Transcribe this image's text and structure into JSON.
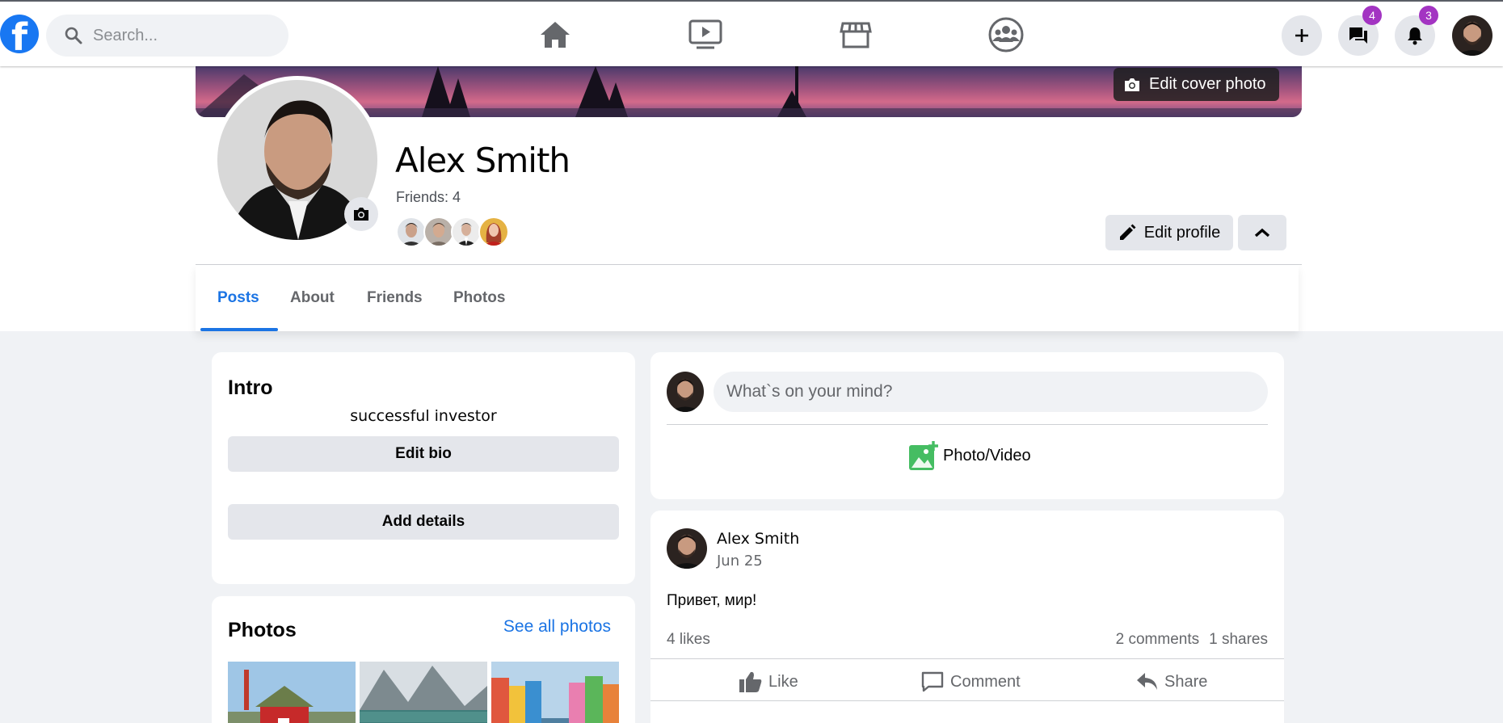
{
  "topbar": {
    "logo_letter": "f",
    "search_placeholder": "Search...",
    "messages_badge": "4",
    "notifications_badge": "3"
  },
  "profile": {
    "edit_cover_label": "Edit cover photo",
    "name": "Alex Smith",
    "friends_label": "Friends: 4",
    "edit_profile_label": "Edit profile"
  },
  "tabs": [
    {
      "label": "Posts",
      "active": true
    },
    {
      "label": "About"
    },
    {
      "label": "Friends"
    },
    {
      "label": "Photos"
    }
  ],
  "intro": {
    "title": "Intro",
    "bio": "successful investor",
    "edit_bio_label": "Edit bio",
    "add_details_label": "Add details"
  },
  "photos_card": {
    "title": "Photos",
    "see_all_label": "See all photos"
  },
  "composer": {
    "placeholder": "What`s on your mind?",
    "photo_video_label": "Photo/Video"
  },
  "post": {
    "author": "Alex Smith",
    "date": "Jun 25",
    "text": "Привет, мир!",
    "likes": "4 likes",
    "comments": "2 comments",
    "shares": "1 shares",
    "like_label": "Like",
    "comment_label": "Comment",
    "share_label": "Share"
  },
  "colors": {
    "accent": "#1b74e4",
    "badge": "#a334c2",
    "photo_icon": "#45bd62"
  }
}
